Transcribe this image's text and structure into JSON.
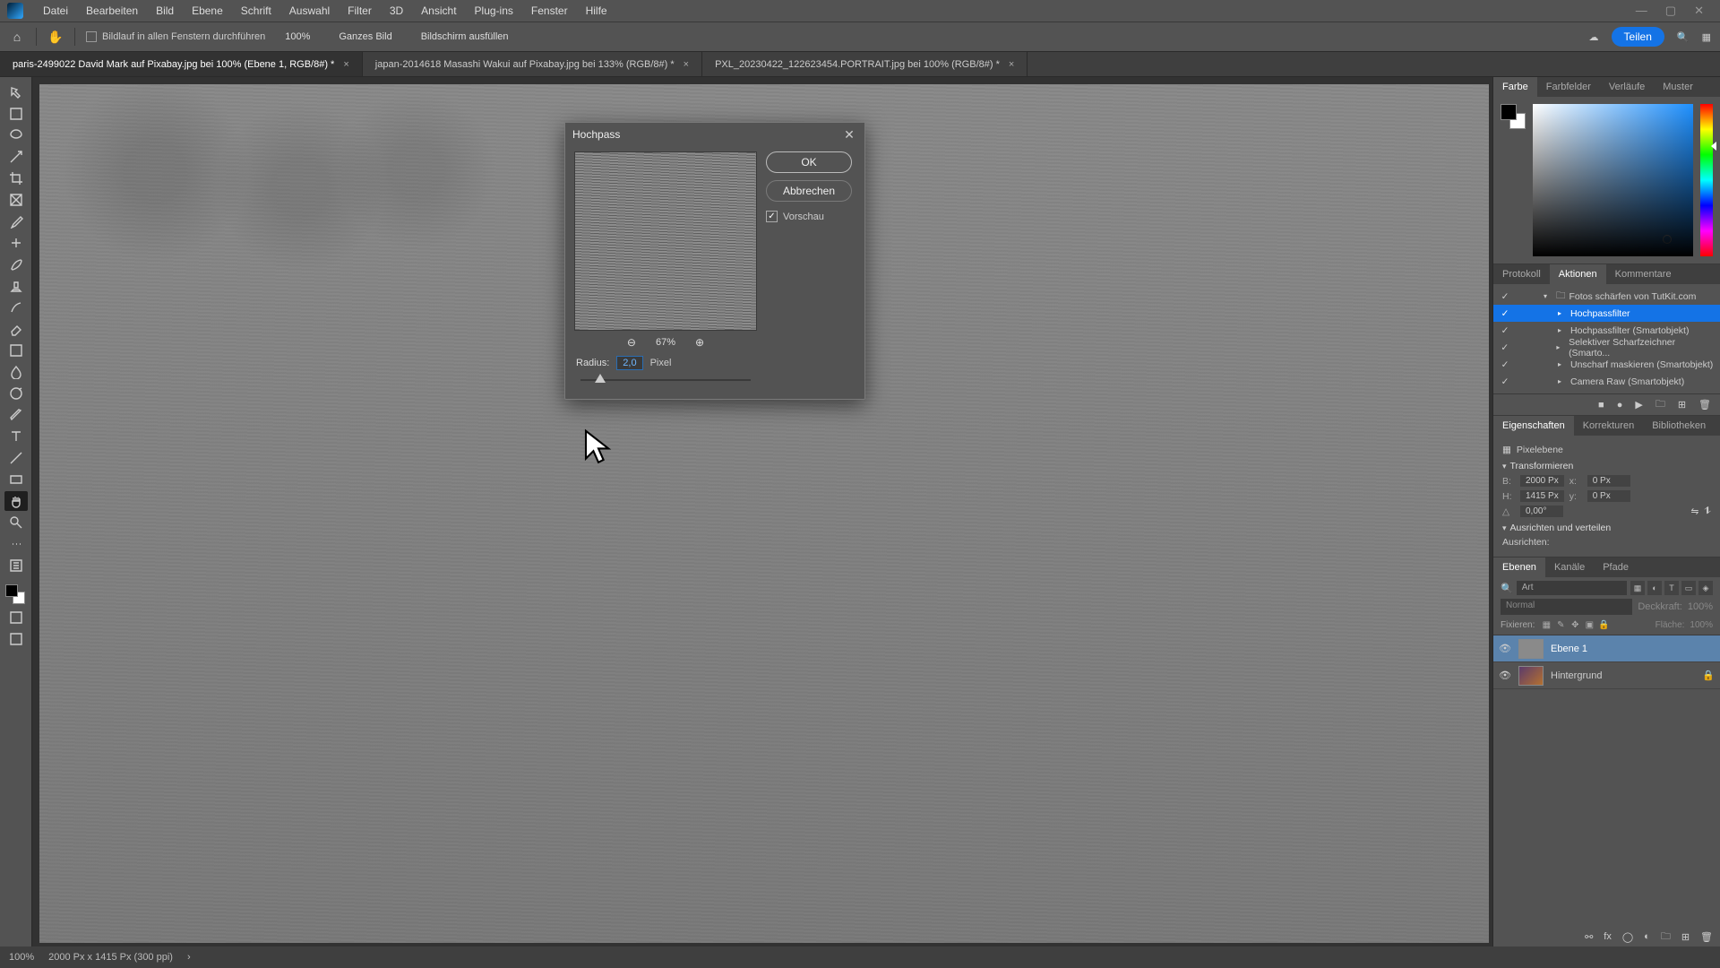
{
  "menu": [
    "Datei",
    "Bearbeiten",
    "Bild",
    "Ebene",
    "Schrift",
    "Auswahl",
    "Filter",
    "3D",
    "Ansicht",
    "Plug-ins",
    "Fenster",
    "Hilfe"
  ],
  "optbar": {
    "scroll_all": "Bildlauf in allen Fenstern durchführen",
    "zoom": "100%",
    "fit_all": "Ganzes Bild",
    "fill_screen": "Bildschirm ausfüllen",
    "share": "Teilen"
  },
  "tabs": [
    {
      "label": "paris-2499022  David Mark auf Pixabay.jpg bei 100% (Ebene 1, RGB/8#) *",
      "active": true
    },
    {
      "label": "japan-2014618 Masashi Wakui auf Pixabay.jpg bei 133% (RGB/8#) *",
      "active": false
    },
    {
      "label": "PXL_20230422_122623454.PORTRAIT.jpg bei 100% (RGB/8#) *",
      "active": false
    }
  ],
  "dialog": {
    "title": "Hochpass",
    "ok": "OK",
    "cancel": "Abbrechen",
    "preview": "Vorschau",
    "zoom": "67%",
    "radius_label": "Radius:",
    "radius_value": "2,0",
    "radius_unit": "Pixel"
  },
  "color_tabs": [
    "Farbe",
    "Farbfelder",
    "Verläufe",
    "Muster"
  ],
  "history_tabs": [
    "Protokoll",
    "Aktionen",
    "Kommentare"
  ],
  "actions": [
    {
      "label": "Fotos schärfen von TutKit.com",
      "indent": 0,
      "folder": true
    },
    {
      "label": "Hochpassfilter",
      "indent": 1,
      "sel": true
    },
    {
      "label": "Hochpassfilter (Smartobjekt)",
      "indent": 1
    },
    {
      "label": "Selektiver Scharfzeichner (Smarto...",
      "indent": 1
    },
    {
      "label": "Unscharf maskieren (Smartobjekt)",
      "indent": 1
    },
    {
      "label": "Camera Raw (Smartobjekt)",
      "indent": 1
    }
  ],
  "props_tabs": [
    "Eigenschaften",
    "Korrekturen",
    "Bibliotheken"
  ],
  "props": {
    "kind": "Pixelebene",
    "transform_h": "Transformieren",
    "w": "2000 Px",
    "h": "1415 Px",
    "x": "0 Px",
    "y": "0 Px",
    "angle": "0,00°",
    "align_h": "Ausrichten und verteilen",
    "align_lab": "Ausrichten:"
  },
  "layers_tabs": [
    "Ebenen",
    "Kanäle",
    "Pfade"
  ],
  "layers": {
    "kind": "Art",
    "blend": "Normal",
    "opacity_lab": "Deckkraft:",
    "opacity": "100%",
    "lock_lab": "Fixieren:",
    "fill_lab": "Fläche:",
    "fill": "100%",
    "items": [
      {
        "name": "Ebene 1",
        "sel": true,
        "bg": false,
        "locked": false
      },
      {
        "name": "Hintergrund",
        "sel": false,
        "bg": true,
        "locked": true
      }
    ]
  },
  "status": {
    "zoom": "100%",
    "dims": "2000 Px x 1415 Px (300 ppi)"
  }
}
